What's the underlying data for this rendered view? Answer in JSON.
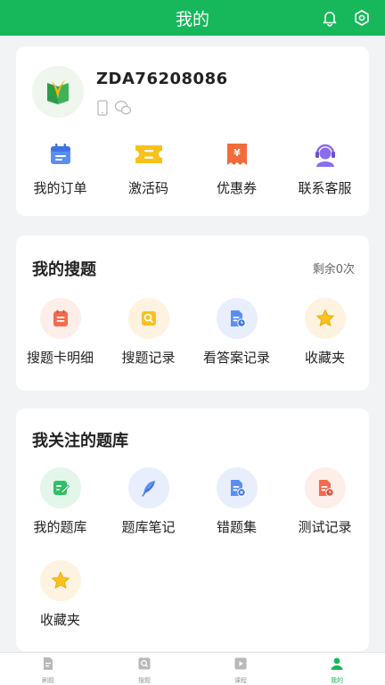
{
  "header": {
    "title": "我的"
  },
  "profile": {
    "username": "ZDA76208086",
    "shortcuts": [
      {
        "label": "我的订单",
        "icon": "calendar-icon"
      },
      {
        "label": "激活码",
        "icon": "ticket-icon"
      },
      {
        "label": "优惠券",
        "icon": "coupon-icon"
      },
      {
        "label": "联系客服",
        "icon": "customer-service-icon"
      }
    ]
  },
  "search_section": {
    "title": "我的搜题",
    "remaining": "剩余0次",
    "items": [
      {
        "label": "搜题卡明细",
        "icon": "card-detail-icon"
      },
      {
        "label": "搜题记录",
        "icon": "search-record-icon"
      },
      {
        "label": "看答案记录",
        "icon": "answer-record-icon"
      },
      {
        "label": "收藏夹",
        "icon": "star-icon"
      }
    ]
  },
  "bank_section": {
    "title": "我关注的题库",
    "items": [
      {
        "label": "我的题库",
        "icon": "edit-icon"
      },
      {
        "label": "题库笔记",
        "icon": "feather-icon"
      },
      {
        "label": "错题集",
        "icon": "wrong-question-icon"
      },
      {
        "label": "测试记录",
        "icon": "test-record-icon"
      },
      {
        "label": "收藏夹",
        "icon": "star-icon"
      }
    ]
  },
  "tabbar": {
    "tabs": [
      {
        "label": "刷题",
        "active": false
      },
      {
        "label": "搜题",
        "active": false
      },
      {
        "label": "课程",
        "active": false
      },
      {
        "label": "我的",
        "active": true
      }
    ]
  },
  "colors": {
    "brand": "#17b85b"
  }
}
